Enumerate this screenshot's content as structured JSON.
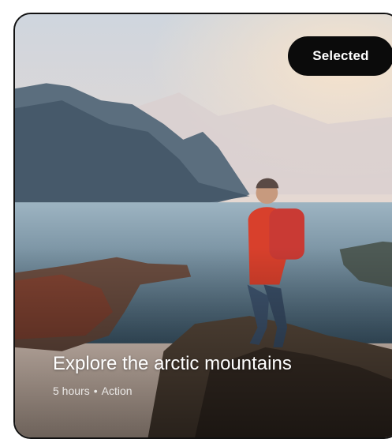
{
  "card": {
    "badge_label": "Selected",
    "title": "Explore the arctic mountains",
    "duration": "5 hours",
    "separator": "•",
    "category": "Action"
  }
}
